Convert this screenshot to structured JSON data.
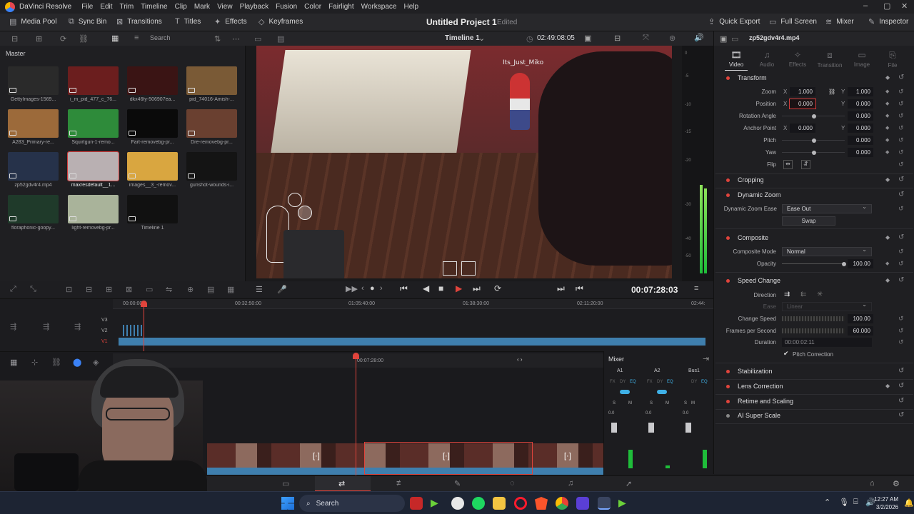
{
  "app": {
    "name": "DaVinci Resolve"
  },
  "menu": [
    "File",
    "Edit",
    "Trim",
    "Timeline",
    "Clip",
    "Mark",
    "View",
    "Playback",
    "Fusion",
    "Color",
    "Fairlight",
    "Workspace",
    "Help"
  ],
  "toolbar": {
    "media_pool": "Media Pool",
    "sync_bin": "Sync Bin",
    "transitions": "Transitions",
    "titles": "Titles",
    "effects": "Effects",
    "keyframes": "Keyframes",
    "project_title": "Untitled Project 1",
    "project_status": "Edited",
    "quick_export": "Quick Export",
    "full_screen": "Full Screen",
    "mixer": "Mixer",
    "inspector": "Inspector"
  },
  "mediapool": {
    "search_placeholder": "Search",
    "bin": "Master",
    "clips": [
      {
        "label": "GettyImages-1569...",
        "color": "#2a2a2a"
      },
      {
        "label": "i_m_pid_477_c_76...",
        "color": "#6b1e1e"
      },
      {
        "label": "dkx46fy-506907ea...",
        "color": "#3a1414"
      },
      {
        "label": "pid_74016-Amish-...",
        "color": "#7a5a36"
      },
      {
        "label": "A283_Primary-re...",
        "color": "#9c6a3a"
      },
      {
        "label": "Squirtgun-1-remo...",
        "color": "#2e8b3a"
      },
      {
        "label": "Fart-removebg-pr...",
        "color": "#0a0a0a"
      },
      {
        "label": "Dre-removebg-pr...",
        "color": "#6a4030"
      },
      {
        "label": "zp52gdv4r4.mp4",
        "color": "#26324a"
      },
      {
        "label": "maxresdefault__1...",
        "color": "#b9b0b2",
        "selected": true
      },
      {
        "label": "images__3_-remov...",
        "color": "#d9a640"
      },
      {
        "label": "gunshot-wounds-i...",
        "color": "#141414"
      },
      {
        "label": "floraphonic-goopy...",
        "color": "#1f3a2a"
      },
      {
        "label": "light-removebg-pr...",
        "color": "#a9b39a"
      },
      {
        "label": "Timeline 1",
        "color": "#111111"
      }
    ]
  },
  "viewer": {
    "timeline_name": "Timeline 1",
    "source_tc": "02:49:08:05",
    "overlay_username": "Its_Just_Miko",
    "timecode": "00:07:28:03"
  },
  "meter_scale": [
    "0",
    "-5",
    "-10",
    "-15",
    "-20",
    "-30",
    "-40",
    "-50"
  ],
  "inspector": {
    "clip_name": "zp52gdv4r4.mp4",
    "tabs": [
      "Video",
      "Audio",
      "Effects",
      "Transition",
      "Image",
      "File"
    ],
    "transform": {
      "title": "Transform",
      "zoom_label": "Zoom",
      "zoom_x": "1.000",
      "zoom_y": "1.000",
      "position_label": "Position",
      "position_x": "0.000",
      "position_y": "0.000",
      "rotation_label": "Rotation Angle",
      "rotation": "0.000",
      "anchor_label": "Anchor Point",
      "anchor_x": "0.000",
      "anchor_y": "0.000",
      "pitch_label": "Pitch",
      "pitch": "0.000",
      "yaw_label": "Yaw",
      "yaw": "0.000",
      "flip_label": "Flip"
    },
    "cropping": "Cropping",
    "dynamic_zoom": {
      "title": "Dynamic Zoom",
      "ease_label": "Dynamic Zoom Ease",
      "ease_value": "Ease Out",
      "swap": "Swap"
    },
    "composite": {
      "title": "Composite",
      "mode_label": "Composite Mode",
      "mode_value": "Normal",
      "opacity_label": "Opacity",
      "opacity": "100.00"
    },
    "speed": {
      "title": "Speed Change",
      "direction_label": "Direction",
      "ease_label": "Ease",
      "ease_value": "Linear",
      "change_label": "Change Speed",
      "change_value": "100.00",
      "fps_label": "Frames per Second",
      "fps_value": "60.000",
      "duration_label": "Duration",
      "duration_value": "00:00:02:11",
      "pitch_correction": "Pitch Correction"
    },
    "stabilization": "Stabilization",
    "lens_correction": "Lens Correction",
    "retime": "Retime and Scaling",
    "ai_super_scale": "AI Super Scale"
  },
  "timeline": {
    "ruler_upper": [
      "00:00:00",
      "00:32:50:00",
      "01:05:40:00",
      "01:38:30:00",
      "02:11:20:00",
      "02:44:"
    ],
    "tracks_upper": [
      "V3",
      "V2",
      "V1"
    ],
    "ruler_lower": "00:07:28:00",
    "track_lower_label": "V3"
  },
  "mixer": {
    "title": "Mixer",
    "channels": [
      "A1",
      "A2",
      "Bus1"
    ],
    "fx": "FX",
    "dy": "DY",
    "eq": "EQ",
    "s": "S",
    "m": "M",
    "level": "0.0"
  },
  "taskbar": {
    "search": "Search",
    "time": "12:27 AM",
    "date": "3/2/2026"
  }
}
